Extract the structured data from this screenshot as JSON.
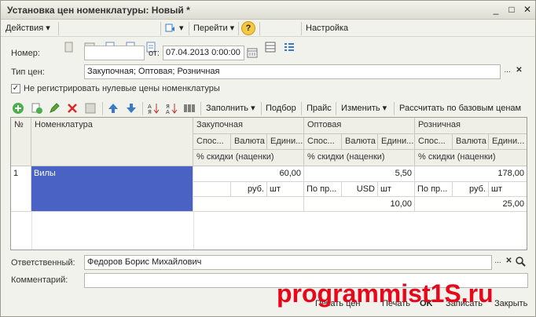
{
  "window": {
    "title": "Установка цен номенклатуры: Новый *",
    "controls": [
      "_",
      "□",
      "✕"
    ]
  },
  "toolbar": {
    "actions_label": "Действия",
    "goto_label": "Перейти",
    "settings_label": "Настройка",
    "help_icon": "?"
  },
  "form": {
    "number_label": "Номер:",
    "number_value": "",
    "date_label": "от:",
    "date_value": "07.04.2013  0:00:00",
    "price_type_label": "Тип цен:",
    "price_type_value": "Закупочная; Оптовая; Розничная",
    "zero_checkbox_label": "Не регистрировать нулевые цены номенклатуры",
    "zero_checkbox_checked": true,
    "responsible_label": "Ответственный:",
    "responsible_value": "Федоров Борис Михайлович",
    "comment_label": "Комментарий:",
    "comment_value": ""
  },
  "table_toolbar": {
    "fill_label": "Заполнить",
    "select_label": "Подбор",
    "price_list_label": "Прайс",
    "change_label": "Изменить",
    "recalc_label": "Рассчитать по базовым ценам"
  },
  "grid": {
    "col_num": "№",
    "col_item": "Номенклатура",
    "groups": [
      {
        "name": "Закупочная",
        "method": "Спос...",
        "currency": "Валюта",
        "unit": "Едини...",
        "discount": "% скидки (наценки)"
      },
      {
        "name": "Оптовая",
        "method": "Спос...",
        "currency": "Валюта",
        "unit": "Едини...",
        "discount": "% скидки (наценки)"
      },
      {
        "name": "Розничная",
        "method": "Спос...",
        "currency": "Валюта",
        "unit": "Едини...",
        "discount": "% скидки (наценки)"
      }
    ],
    "row": {
      "num": "1",
      "item": "Вилы",
      "groups": [
        {
          "price": "60,00",
          "method": "",
          "currency": "руб.",
          "unit": "шт",
          "discount": ""
        },
        {
          "price": "5,50",
          "method": "По пр...",
          "currency": "USD",
          "unit": "шт",
          "discount": "10,00"
        },
        {
          "price": "178,00",
          "method": "По пр...",
          "currency": "руб.",
          "unit": "шт",
          "discount": "25,00"
        }
      ]
    }
  },
  "buttons": {
    "print_prices": "Печать цен",
    "print": "Печать",
    "ok": "OK",
    "save": "Записать",
    "close": "Закрыть"
  },
  "watermark": "programmist1S.ru",
  "colors": {
    "selected_cell": "#4a62c3",
    "watermark": "#e8061b"
  }
}
